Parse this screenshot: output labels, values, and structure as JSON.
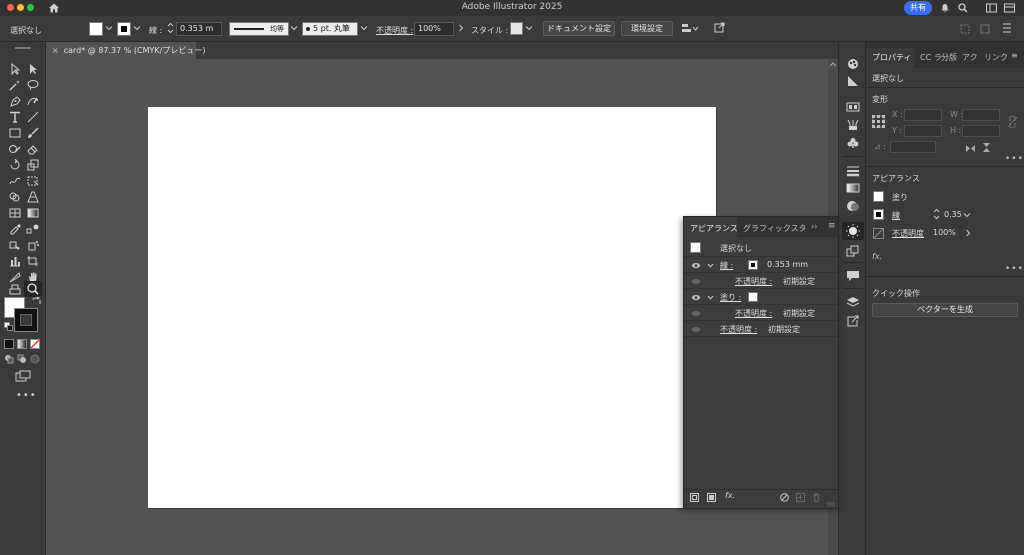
{
  "window": {
    "title": "Adobe Illustrator 2025",
    "share": "共有"
  },
  "control_bar": {
    "selection": "選択なし",
    "stroke_label": "線 :",
    "stroke_weight": "0.353 m",
    "profile": "均等",
    "brush": "5 pt. 丸筆",
    "opacity_label": "不透明度 :",
    "opacity_value": "100%",
    "style_label": "スタイル :",
    "doc_settings": "ドキュメント設定",
    "preferences": "環境設定"
  },
  "document_tab": {
    "label": "card* @ 87.37 % (CMYK/プレビュー)"
  },
  "properties": {
    "tabs": [
      "プロパティ",
      "CC ラ",
      "分版",
      "アク",
      "リンク"
    ],
    "selection": "選択なし",
    "transform_title": "変形",
    "x_label": "X :",
    "y_label": "Y :",
    "w_label": "W :",
    "h_label": "H :",
    "angle_label": "⊿ :",
    "appearance_title": "アピアランス",
    "fill_label": "塗り",
    "stroke_label": "線",
    "stroke_value": "0.35",
    "opacity_label": "不透明度",
    "opacity_value": "100%",
    "fx": "fx.",
    "quick_actions_title": "クイック操作",
    "vectorize_button": "ベクターを生成"
  },
  "appearance_panel": {
    "tabs": [
      "アピアランス",
      "グラフィックスタ"
    ],
    "selection": "選択なし",
    "rows": {
      "stroke_label": "線 :",
      "stroke_value": "0.353 mm",
      "opacity_label": "不透明度 :",
      "default": "初期設定",
      "fill_label": "塗り :"
    },
    "fx": "fx."
  },
  "colors": {
    "accent": "#3b6df2",
    "panel": "#3a3a3a",
    "canvas": "#535353",
    "artboard": "#ffffff"
  }
}
